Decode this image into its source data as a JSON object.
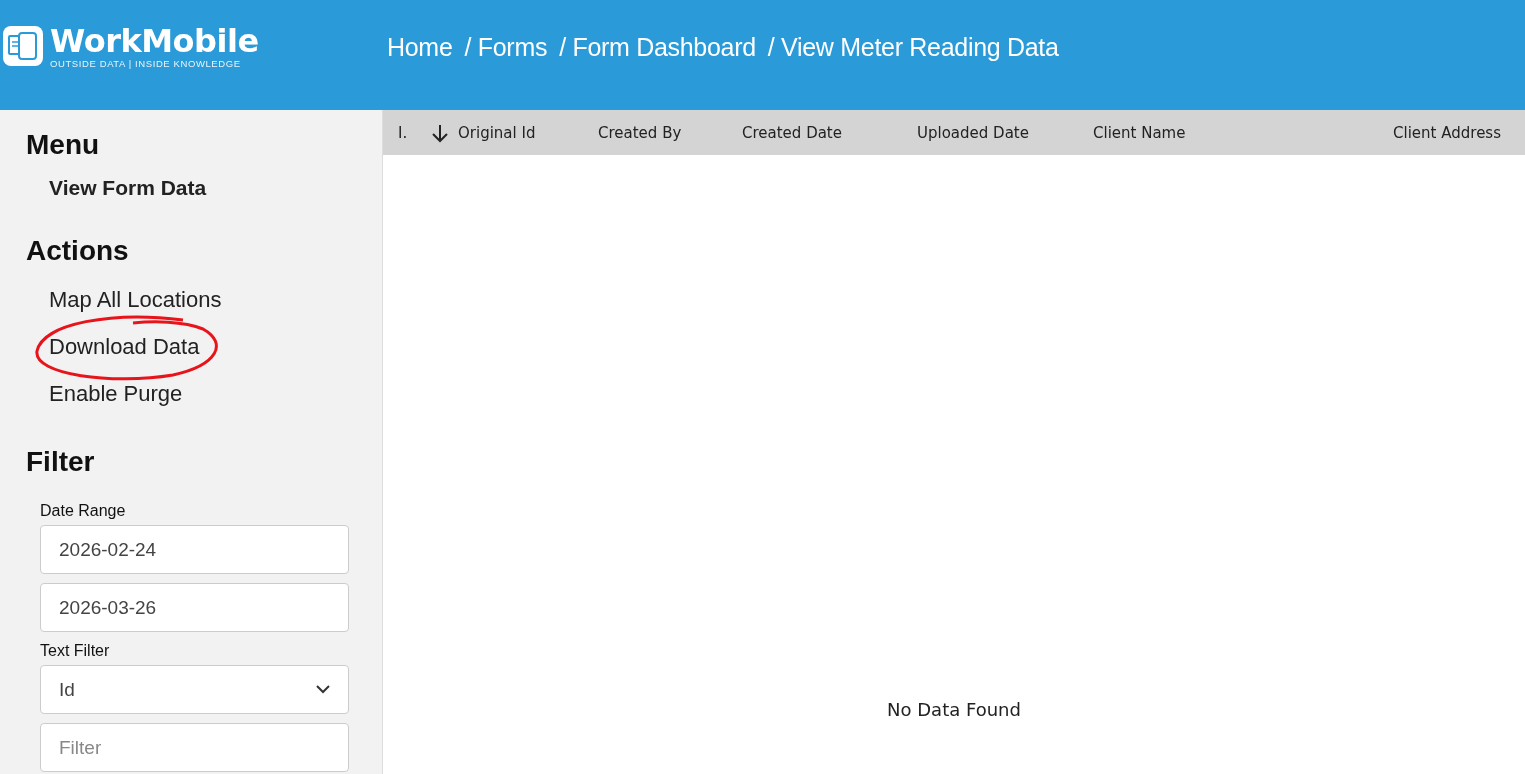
{
  "header": {
    "logo": {
      "name": "WorkMobile",
      "tagline": "OUTSIDE DATA | INSIDE KNOWLEDGE"
    },
    "breadcrumb": [
      "Home",
      "/ Forms",
      "/ Form Dashboard",
      "/ View Meter Reading Data"
    ]
  },
  "sidebar": {
    "menu": {
      "title": "Menu",
      "items": [
        {
          "label": "View Form Data",
          "selected": true
        }
      ]
    },
    "actions": {
      "title": "Actions",
      "items": [
        {
          "label": "Map All Locations",
          "circled": false
        },
        {
          "label": "Download Data",
          "circled": true
        },
        {
          "label": "Enable Purge",
          "circled": false
        }
      ]
    },
    "filter": {
      "title": "Filter",
      "date_range": {
        "label": "Date Range",
        "from": "2026-02-24",
        "to": "2026-03-26"
      },
      "text_filter": {
        "label": "Text Filter",
        "field": "Id",
        "placeholder": "Filter"
      }
    }
  },
  "table": {
    "columns": [
      "I.",
      "Original Id",
      "Created By",
      "Created Date",
      "Uploaded Date",
      "Client Name",
      "Client Address"
    ],
    "empty_message": "No Data Found"
  }
}
